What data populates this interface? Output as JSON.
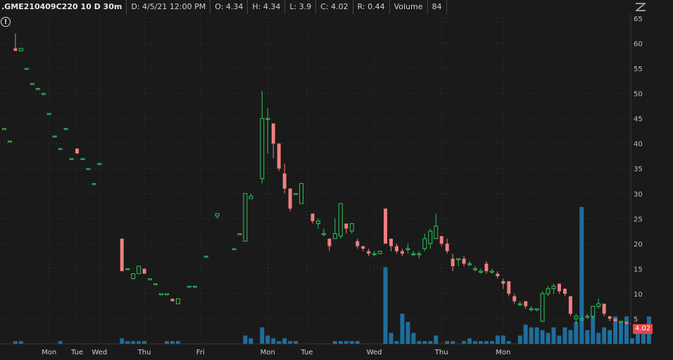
{
  "header": {
    "symbol": ".GME210409C220 10 D 30m",
    "date": "D: 4/5/21 12:00 PM",
    "open": "O: 4.34",
    "high": "H: 4.34",
    "low": "L: 3.9",
    "close": "C: 4.02",
    "range": "R: 0.44",
    "volume_label": "Volume",
    "volume_value": "84"
  },
  "icons": {
    "alert": "!",
    "menu": "settings-menu-icon"
  },
  "last_price_label": "4.02",
  "colors": {
    "up": "#2fc55a",
    "down": "#f07f7f",
    "volume": "#1f6e9c",
    "grid": "#3a3a3a",
    "badge": "#e84545"
  },
  "chart_data": {
    "type": "candlestick",
    "ylim": [
      0,
      65
    ],
    "yticks": [
      5,
      10,
      15,
      20,
      25,
      30,
      35,
      40,
      45,
      50,
      55,
      60,
      65
    ],
    "day_labels": [
      "Mon",
      "Tue",
      "Wed",
      "Thu",
      "Fri",
      "Mon",
      "Tue",
      "Wed",
      "Thu",
      "Mon"
    ],
    "day_label_bars": [
      8,
      13,
      17,
      25,
      35,
      47,
      54,
      66,
      78,
      89
    ],
    "candles": [
      [
        43,
        43,
        43,
        43
      ],
      [
        40.5,
        40.5,
        40.5,
        40.5
      ],
      [
        59,
        62,
        58.5,
        58.5
      ],
      [
        58.5,
        59,
        58.5,
        59
      ],
      [
        55,
        55,
        55,
        55
      ],
      [
        52,
        52,
        52,
        52
      ],
      [
        51,
        51,
        51,
        51
      ],
      [
        50,
        50,
        50,
        50
      ],
      [
        46,
        46,
        46,
        46
      ],
      [
        41.5,
        41.5,
        41.5,
        41.5
      ],
      [
        39,
        39,
        39,
        39
      ],
      [
        43,
        43,
        43,
        43
      ],
      [
        37,
        37,
        37,
        37
      ],
      [
        39,
        39,
        38,
        38
      ],
      [
        37,
        37,
        37,
        37
      ],
      [
        35,
        35,
        35,
        35
      ],
      [
        32,
        32,
        32,
        32
      ],
      [
        36,
        36,
        36,
        36
      ],
      [
        null,
        null,
        null,
        null
      ],
      [
        null,
        null,
        null,
        null
      ],
      [
        null,
        null,
        null,
        null
      ],
      [
        21,
        21,
        14.5,
        14.5
      ],
      [
        15,
        15,
        15,
        15
      ],
      [
        13,
        14,
        13,
        14
      ],
      [
        14,
        15.5,
        14,
        15.5
      ],
      [
        15,
        15,
        14,
        14
      ],
      [
        13,
        13,
        13,
        13
      ],
      [
        12,
        12,
        12,
        12
      ],
      [
        10,
        10,
        10,
        10
      ],
      [
        10,
        10,
        10,
        10
      ],
      [
        9,
        9,
        8.5,
        8.5
      ],
      [
        8,
        9,
        8,
        9
      ],
      [
        null,
        null,
        null,
        null
      ],
      [
        11.5,
        11.5,
        11.5,
        11.5
      ],
      [
        11.5,
        11.5,
        11.5,
        11.5
      ],
      [
        null,
        null,
        null,
        null
      ],
      [
        17.5,
        17.5,
        17.5,
        17.5
      ],
      [
        null,
        null,
        null,
        null
      ],
      [
        25.5,
        26,
        25,
        26
      ],
      [
        null,
        null,
        null,
        null
      ],
      [
        null,
        null,
        null,
        null
      ],
      [
        19,
        19,
        19,
        19
      ],
      [
        22,
        22,
        22,
        22
      ],
      [
        20.5,
        30,
        20.5,
        30
      ],
      [
        29,
        30,
        29,
        29.5
      ],
      [
        null,
        null,
        null,
        null
      ],
      [
        33,
        50.5,
        32,
        45
      ],
      [
        45,
        47,
        38,
        45
      ],
      [
        44,
        44,
        37,
        40
      ],
      [
        40,
        40,
        34.5,
        35
      ],
      [
        34,
        36,
        30,
        31
      ],
      [
        31,
        31,
        26.5,
        27
      ],
      [
        30,
        30,
        30,
        30
      ],
      [
        28,
        32,
        28,
        32
      ],
      [
        null,
        null,
        null,
        null
      ],
      [
        26,
        26,
        24,
        24.5
      ],
      [
        24,
        25,
        23,
        24.5
      ],
      [
        22,
        23,
        21.5,
        22
      ],
      [
        21,
        21,
        18.5,
        19.5
      ],
      [
        21,
        25,
        21,
        22
      ],
      [
        21.5,
        28,
        21,
        28
      ],
      [
        24,
        24,
        22,
        23
      ],
      [
        22.5,
        24,
        22,
        24
      ],
      [
        20.5,
        21,
        19,
        19.5
      ],
      [
        19.5,
        19.5,
        18.5,
        19
      ],
      [
        18.5,
        19,
        17.5,
        18
      ],
      [
        18,
        18.5,
        17.5,
        18
      ],
      [
        18,
        18.5,
        18,
        18.5
      ],
      [
        27,
        27,
        20,
        20
      ],
      [
        21,
        21,
        18.5,
        19.5
      ],
      [
        19.5,
        20,
        18,
        18.5
      ],
      [
        18.5,
        19,
        17.5,
        18
      ],
      [
        19,
        20,
        18,
        19
      ],
      [
        18,
        18.5,
        17.5,
        18
      ],
      [
        18,
        18.5,
        17,
        18
      ],
      [
        19,
        22,
        18.5,
        21
      ],
      [
        20,
        23,
        19,
        22.5
      ],
      [
        21,
        26,
        21,
        23.5
      ],
      [
        21.5,
        21.5,
        19.5,
        20
      ],
      [
        20,
        21,
        18,
        18.5
      ],
      [
        17,
        18,
        14.5,
        15.5
      ],
      [
        17,
        17,
        15.5,
        17
      ],
      [
        17,
        17.5,
        15.5,
        16
      ],
      [
        16,
        16.5,
        15.5,
        16
      ],
      [
        15,
        15.5,
        14.5,
        15
      ],
      [
        14.5,
        15,
        14,
        14.5
      ],
      [
        16,
        16.5,
        14,
        14.5
      ],
      [
        14.5,
        15,
        14,
        14.5
      ],
      [
        14,
        14.5,
        13,
        13.5
      ],
      [
        12.5,
        13,
        11,
        12
      ],
      [
        12.5,
        12.5,
        9.5,
        10
      ],
      [
        9.5,
        10,
        8,
        8.5
      ],
      [
        8,
        8.5,
        7.5,
        8
      ],
      [
        8.5,
        8.5,
        7,
        7.5
      ],
      [
        7,
        7.5,
        6.5,
        7
      ],
      [
        7,
        7,
        6.5,
        7
      ],
      [
        4.5,
        10.5,
        4.5,
        10
      ],
      [
        10,
        11.5,
        9.5,
        11
      ],
      [
        11,
        12,
        10,
        11.5
      ],
      [
        12,
        12,
        10,
        10.5
      ],
      [
        11,
        11,
        9.5,
        10
      ],
      [
        9.5,
        9.5,
        5.5,
        6
      ],
      [
        5,
        6,
        4,
        5.5
      ],
      [
        5,
        5.5,
        4.5,
        5
      ],
      [
        5.5,
        6,
        5,
        5.5
      ],
      [
        5.5,
        7.5,
        5,
        7.5
      ],
      [
        7.5,
        9,
        7,
        8
      ],
      [
        8,
        8,
        5.5,
        6
      ],
      [
        5.5,
        5.5,
        4.5,
        5
      ],
      [
        5,
        5,
        4.5,
        4.5
      ],
      [
        4.5,
        4.5,
        4.5,
        4.5
      ],
      [
        4.34,
        4.34,
        3.9,
        4.02
      ]
    ],
    "volume_ylim": [
      0,
      60
    ],
    "volumes": [
      0,
      0,
      1,
      1,
      0,
      0,
      0,
      0,
      0,
      0,
      1,
      0,
      0,
      0,
      0,
      0,
      0,
      0,
      0,
      0,
      0,
      2,
      1,
      1,
      1,
      1,
      0,
      0,
      0,
      1,
      1,
      1,
      0,
      0,
      0,
      0,
      0,
      0,
      0,
      0,
      0,
      0,
      0,
      3,
      2,
      0,
      6,
      3,
      2,
      1,
      2,
      1,
      1,
      0,
      0,
      0,
      0,
      0,
      0,
      1,
      1,
      1,
      1,
      1,
      0,
      0,
      0,
      0,
      28,
      4,
      1,
      11,
      8,
      4,
      1,
      1,
      1,
      3,
      0,
      1,
      1,
      0,
      1,
      2,
      1,
      1,
      1,
      1,
      3,
      3,
      1,
      0,
      3,
      7,
      6,
      6,
      5,
      4,
      6,
      3,
      6,
      5,
      8,
      50,
      5,
      12,
      4,
      6,
      5,
      10,
      8,
      10,
      2,
      4,
      5,
      10
    ]
  }
}
